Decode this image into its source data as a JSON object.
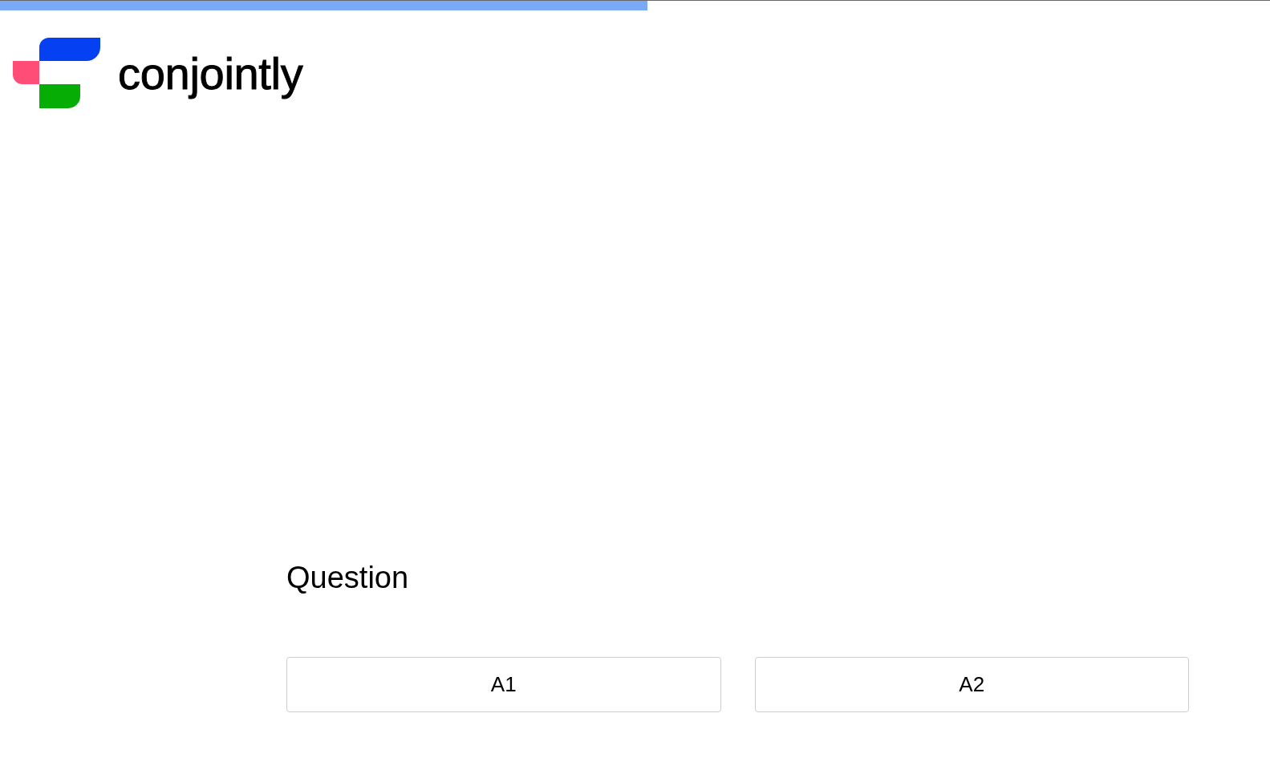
{
  "progress": {
    "level": 0.51
  },
  "header": {
    "logo_text": "conjointly"
  },
  "question": {
    "title": "Question",
    "answers": [
      {
        "label": "A1"
      },
      {
        "label": "A2"
      }
    ]
  }
}
